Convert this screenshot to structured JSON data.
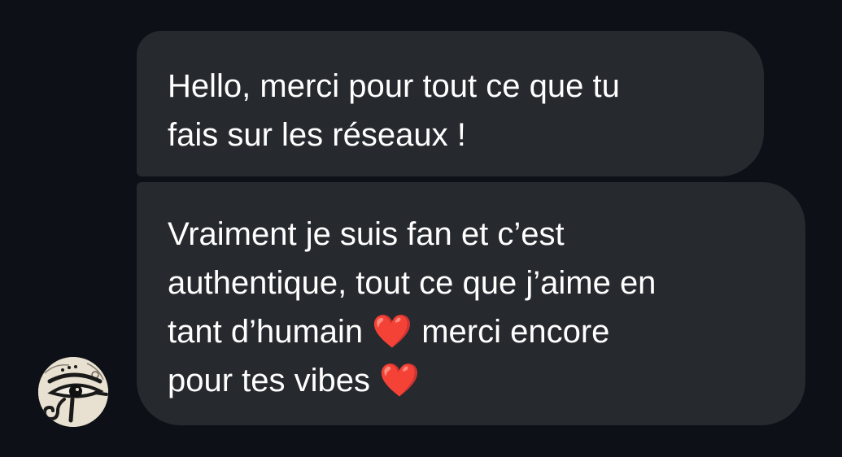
{
  "conversation": {
    "messages": [
      {
        "text": "Hello, merci pour tout ce que tu\nfais sur les réseaux !"
      },
      {
        "text": "Vraiment je suis fan et c’est\nauthentique, tout ce que j’aime en\ntant d’humain ❤️ merci encore\npour tes vibes ❤️"
      }
    ],
    "sender_avatar_icon": "eye-of-horus-icon"
  },
  "colors": {
    "background": "#0d1016",
    "bubble": "#26292e",
    "text": "#ffffff"
  }
}
